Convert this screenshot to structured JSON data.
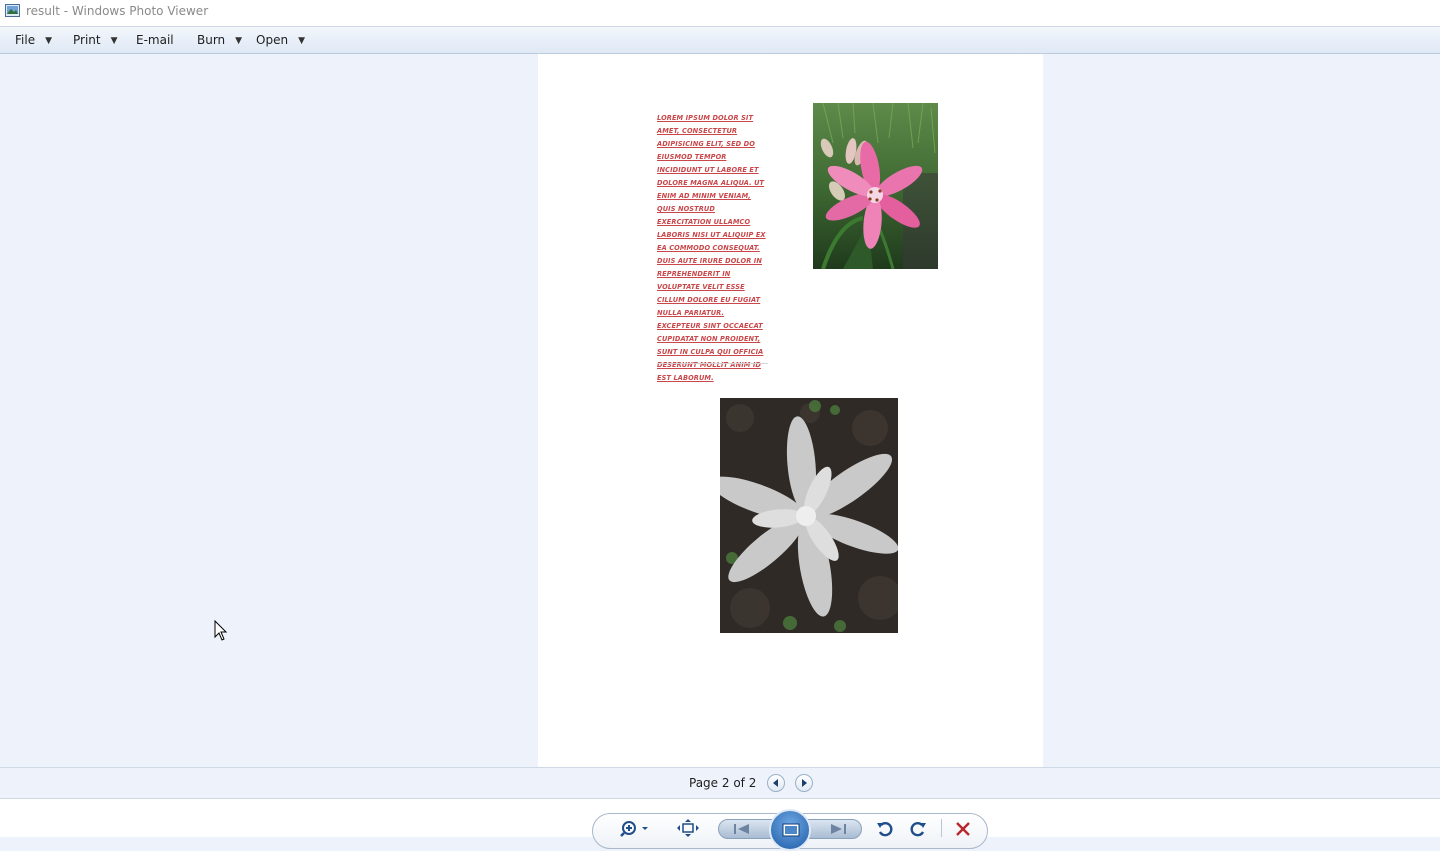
{
  "window": {
    "title": "result - Windows Photo Viewer",
    "icon": "photo-viewer-icon"
  },
  "menu": {
    "file": "File",
    "print": "Print",
    "email": "E-mail",
    "burn": "Burn",
    "open": "Open"
  },
  "document": {
    "text": "Lorem ipsum dolor sit amet, consectetur adipisicing elit, sed do eiusmod tempor incididunt ut labore et dolore magna aliqua. Ut enim ad minim veniam, quis nostrud exercitation ullamco laboris nisi ut aliquip ex ea commodo consequat. Duis aute irure dolor in reprehenderit in voluptate velit esse cillum dolore eu fugiat nulla pariatur. Excepteur sint occaecat cupidatat non proident, sunt in culpa qui officia deserunt mollit anim id est laborum.",
    "text_color": "#c9474a",
    "images": [
      "pink-lily-photo",
      "dusty-miller-plant-photo"
    ]
  },
  "status": {
    "page_indicator": "Page 2 of 2"
  },
  "toolbar": {
    "buttons": [
      "zoom-icon",
      "actual-size-icon",
      "previous-icon",
      "slideshow-icon",
      "next-icon",
      "rotate-counterclockwise-icon",
      "rotate-clockwise-icon",
      "delete-icon"
    ],
    "delete_color": "#b8262c"
  }
}
